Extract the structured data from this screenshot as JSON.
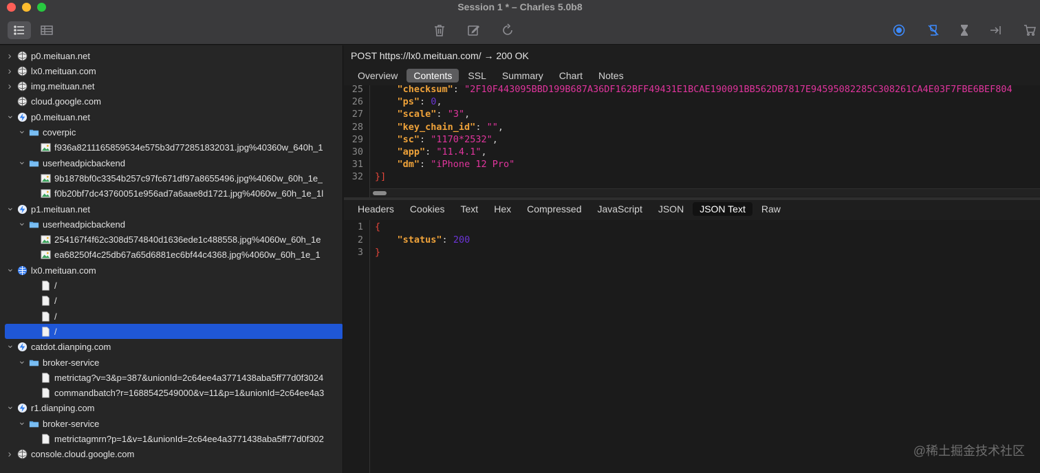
{
  "window": {
    "title": "Session 1 * – Charles 5.0b8"
  },
  "toolbar": {
    "left": [
      {
        "icon": "list-view-icon",
        "active": true
      },
      {
        "icon": "table-view-icon",
        "active": false
      }
    ],
    "center": [
      "trash-icon",
      "edit-icon",
      "refresh-icon"
    ],
    "right": [
      "record-icon",
      "throttle-icon",
      "breakpoint-icon",
      "map-icon",
      "cart-icon"
    ]
  },
  "tree": [
    {
      "label": "p0.meituan.net",
      "icon": "globe",
      "level": 0,
      "chevron": "right"
    },
    {
      "label": "lx0.meituan.com",
      "icon": "globe",
      "level": 0,
      "chevron": "right"
    },
    {
      "label": "img.meituan.net",
      "icon": "globe",
      "level": 0,
      "chevron": "right"
    },
    {
      "label": "cloud.google.com",
      "icon": "globe",
      "level": 0,
      "chevron": ""
    },
    {
      "label": "p0.meituan.net",
      "icon": "bolt",
      "level": 0,
      "chevron": "down"
    },
    {
      "label": "coverpic",
      "icon": "folder",
      "level": 1,
      "chevron": "down"
    },
    {
      "label": "f936a8211165859534e575b3d772851832031.jpg%40360w_640h_1",
      "icon": "image",
      "level": 2,
      "chevron": ""
    },
    {
      "label": "userheadpicbackend",
      "icon": "folder",
      "level": 1,
      "chevron": "down"
    },
    {
      "label": "9b1878bf0c3354b257c97fc671df97a8655496.jpg%4060w_60h_1e_",
      "icon": "image",
      "level": 2,
      "chevron": ""
    },
    {
      "label": "f0b20bf7dc43760051e956ad7a6aae8d1721.jpg%4060w_60h_1e_1l",
      "icon": "image",
      "level": 2,
      "chevron": ""
    },
    {
      "label": "p1.meituan.net",
      "icon": "bolt",
      "level": 0,
      "chevron": "down"
    },
    {
      "label": "userheadpicbackend",
      "icon": "folder",
      "level": 1,
      "chevron": "down"
    },
    {
      "label": "254167f4f62c308d574840d1636ede1c488558.jpg%4060w_60h_1e",
      "icon": "image",
      "level": 2,
      "chevron": ""
    },
    {
      "label": "ea68250f4c25db67a65d6881ec6bf44c4368.jpg%4060w_60h_1e_1",
      "icon": "image",
      "level": 2,
      "chevron": ""
    },
    {
      "label": "lx0.meituan.com",
      "icon": "globe-blue",
      "level": 0,
      "chevron": "down"
    },
    {
      "label": "/",
      "icon": "file",
      "level": 2,
      "chevron": ""
    },
    {
      "label": "/",
      "icon": "file",
      "level": 2,
      "chevron": ""
    },
    {
      "label": "/",
      "icon": "file",
      "level": 2,
      "chevron": ""
    },
    {
      "label": "/",
      "icon": "file",
      "level": 2,
      "chevron": "",
      "selected": true
    },
    {
      "label": "catdot.dianping.com",
      "icon": "bolt",
      "level": 0,
      "chevron": "down"
    },
    {
      "label": "broker-service",
      "icon": "folder",
      "level": 1,
      "chevron": "down"
    },
    {
      "label": "metrictag?v=3&p=387&unionId=2c64ee4a3771438aba5ff77d0f3024",
      "icon": "file",
      "level": 2,
      "chevron": ""
    },
    {
      "label": "commandbatch?r=1688542549000&v=11&p=1&unionId=2c64ee4a3",
      "icon": "file",
      "level": 2,
      "chevron": ""
    },
    {
      "label": "r1.dianping.com",
      "icon": "bolt",
      "level": 0,
      "chevron": "down"
    },
    {
      "label": "broker-service",
      "icon": "folder",
      "level": 1,
      "chevron": "down"
    },
    {
      "label": "metrictagmrn?p=1&v=1&unionId=2c64ee4a3771438aba5ff77d0f302",
      "icon": "file",
      "level": 2,
      "chevron": ""
    },
    {
      "label": "console.cloud.google.com",
      "icon": "globe",
      "level": 0,
      "chevron": "right"
    }
  ],
  "request": {
    "line": "POST https://lx0.meituan.com/  → 200 OK",
    "tabs": [
      "Overview",
      "Contents",
      "SSL",
      "Summary",
      "Chart",
      "Notes"
    ],
    "active_tab": "Contents",
    "code_lines": [
      {
        "n": "25",
        "key": "\"checksum\"",
        "sep": ": ",
        "val": "\"2F10F443095BBD199B687A36DF162BFF49431E1BCAE190091BB562DB7817E94595082285C308261CA4E03F7FBE6BEF804",
        "type": "s",
        "end": ""
      },
      {
        "n": "26",
        "key": "\"ps\"",
        "sep": ": ",
        "val": "0",
        "type": "n",
        "end": ","
      },
      {
        "n": "27",
        "key": "\"scale\"",
        "sep": ": ",
        "val": "\"3\"",
        "type": "s",
        "end": ","
      },
      {
        "n": "28",
        "key": "\"key_chain_id\"",
        "sep": ": ",
        "val": "\"\"",
        "type": "s",
        "end": ","
      },
      {
        "n": "29",
        "key": "\"sc\"",
        "sep": ": ",
        "val": "\"1170*2532\"",
        "type": "s",
        "end": ","
      },
      {
        "n": "30",
        "key": "\"app\"",
        "sep": ": ",
        "val": "\"11.4.1\"",
        "type": "s",
        "end": ","
      },
      {
        "n": "31",
        "key": "\"dm\"",
        "sep": ": ",
        "val": "\"iPhone 12 Pro\"",
        "type": "s",
        "end": ""
      }
    ],
    "closing_line": {
      "n": "32",
      "text": "}]"
    }
  },
  "response": {
    "tabs": [
      "Headers",
      "Cookies",
      "Text",
      "Hex",
      "Compressed",
      "JavaScript",
      "JSON",
      "JSON Text",
      "Raw"
    ],
    "active_tab": "JSON Text",
    "lines": [
      {
        "n": "1",
        "text": "{"
      },
      {
        "n": "2",
        "key": "\"status\"",
        "sep": ": ",
        "val": "200"
      },
      {
        "n": "3",
        "text": "}"
      }
    ]
  },
  "watermark": "@稀土掘金技术社区"
}
